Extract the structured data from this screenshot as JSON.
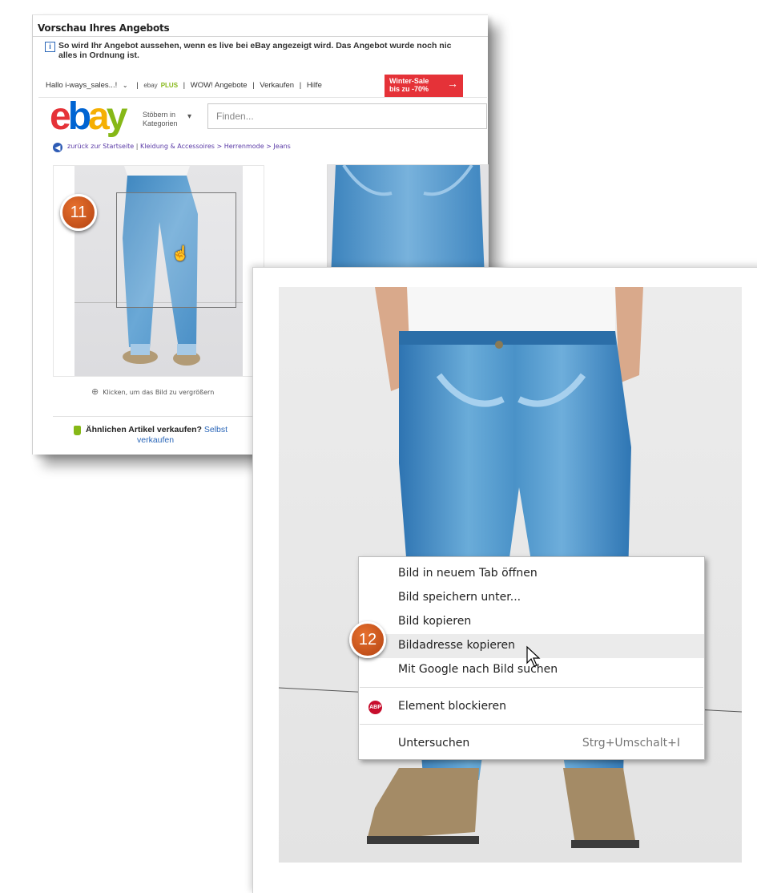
{
  "preview": {
    "title": "Vorschau Ihres Angebots",
    "info_line1": "So wird Ihr Angebot aussehen, wenn es live bei eBay angezeigt wird. Das Angebot wurde noch nic",
    "info_line2": "alles in Ordnung ist.",
    "nav": {
      "greeting": "Hallo i-ways_sales...!",
      "plus_prefix": "ebay",
      "plus_suffix": "PLUS",
      "deals": "WOW! Angebote",
      "sell": "Verkaufen",
      "help": "Hilfe",
      "promo_line1": "Winter-Sale",
      "promo_line2": "bis zu -70%"
    },
    "logo": {
      "e": "e",
      "b": "b",
      "a": "a",
      "y": "y"
    },
    "shop_by_category_line1": "Stöbern in",
    "shop_by_category_line2": "Kategorien",
    "search_placeholder": "Finden...",
    "back_link": "zurück zur Startseite",
    "breadcrumb": "Kleidung & Accessoires > Herrenmode > Jeans",
    "zoom_hint": "Klicken, um das Bild zu vergrößern",
    "sell_similar": "Ähnlichen Artikel verkaufen?",
    "sell_link1": "Selbst",
    "sell_link2": "verkaufen",
    "badge_11": "11"
  },
  "context_menu": {
    "items": [
      {
        "label": "Bild in neuem Tab öffnen"
      },
      {
        "label": "Bild speichern unter..."
      },
      {
        "label": "Bild kopieren"
      },
      {
        "label": "Bildadresse kopieren"
      },
      {
        "label": "Mit Google nach Bild suchen"
      },
      {
        "label": "Element blockieren",
        "icon": "adblock-plus-icon"
      },
      {
        "label": "Untersuchen",
        "shortcut": "Strg+Umschalt+I"
      }
    ],
    "hovered_item": "Bildadresse kopieren",
    "abp_text": "ABP"
  },
  "badge_12": "12",
  "colors": {
    "badge": "#d2561f",
    "ebay_red": "#e53238",
    "ebay_blue": "#0064d2",
    "ebay_yellow": "#f5af02",
    "ebay_green": "#86b817",
    "link": "#2a66b8"
  }
}
